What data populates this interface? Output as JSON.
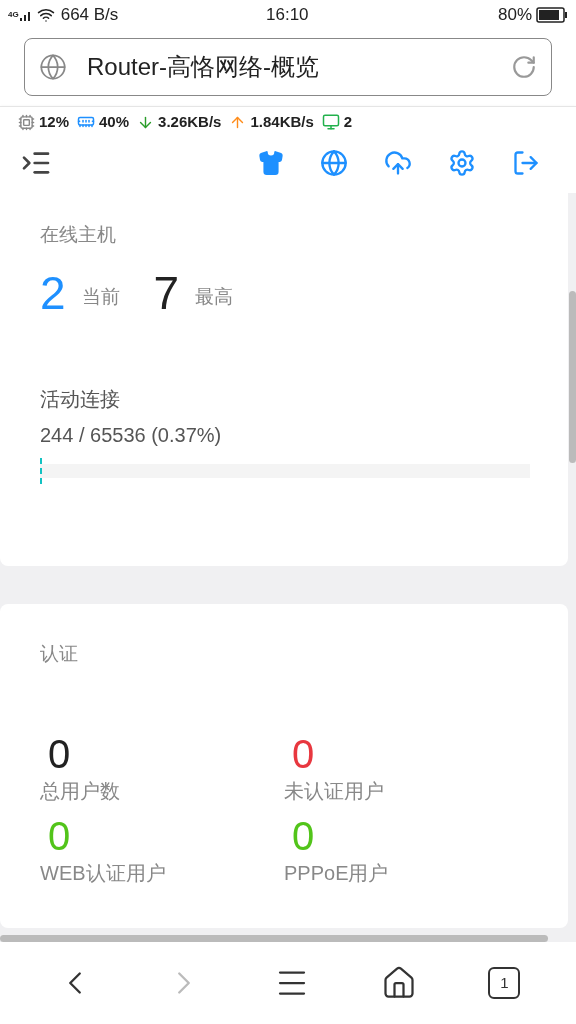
{
  "status_bar": {
    "network": "4G",
    "speed": "664 B/s",
    "time": "16:10",
    "battery": "80%"
  },
  "address_bar": {
    "title": "Router-高恪网络-概览"
  },
  "stats": {
    "cpu": "12%",
    "memory": "40%",
    "download": "3.26KB/s",
    "upload": "1.84KB/s",
    "hosts": "2"
  },
  "online_hosts": {
    "title": "在线主机",
    "current": "2",
    "current_label": "当前",
    "max": "7",
    "max_label": "最高"
  },
  "connections": {
    "title": "活动连接",
    "reading": "244 / 65536 (0.37%)",
    "level": 0.0037
  },
  "auth": {
    "title": "认证",
    "items": [
      {
        "count": "0",
        "label": "总用户数",
        "color": "#222222"
      },
      {
        "count": "0",
        "label": "未认证用户",
        "color": "#e8373f"
      },
      {
        "count": "0",
        "label": "WEB认证用户",
        "color": "#52c41a"
      },
      {
        "count": "0",
        "label": "PPPoE用户",
        "color": "#52c41a"
      }
    ]
  },
  "bottom_nav": {
    "back_disabled": false,
    "forward_disabled": true,
    "tabs_count": "1"
  }
}
